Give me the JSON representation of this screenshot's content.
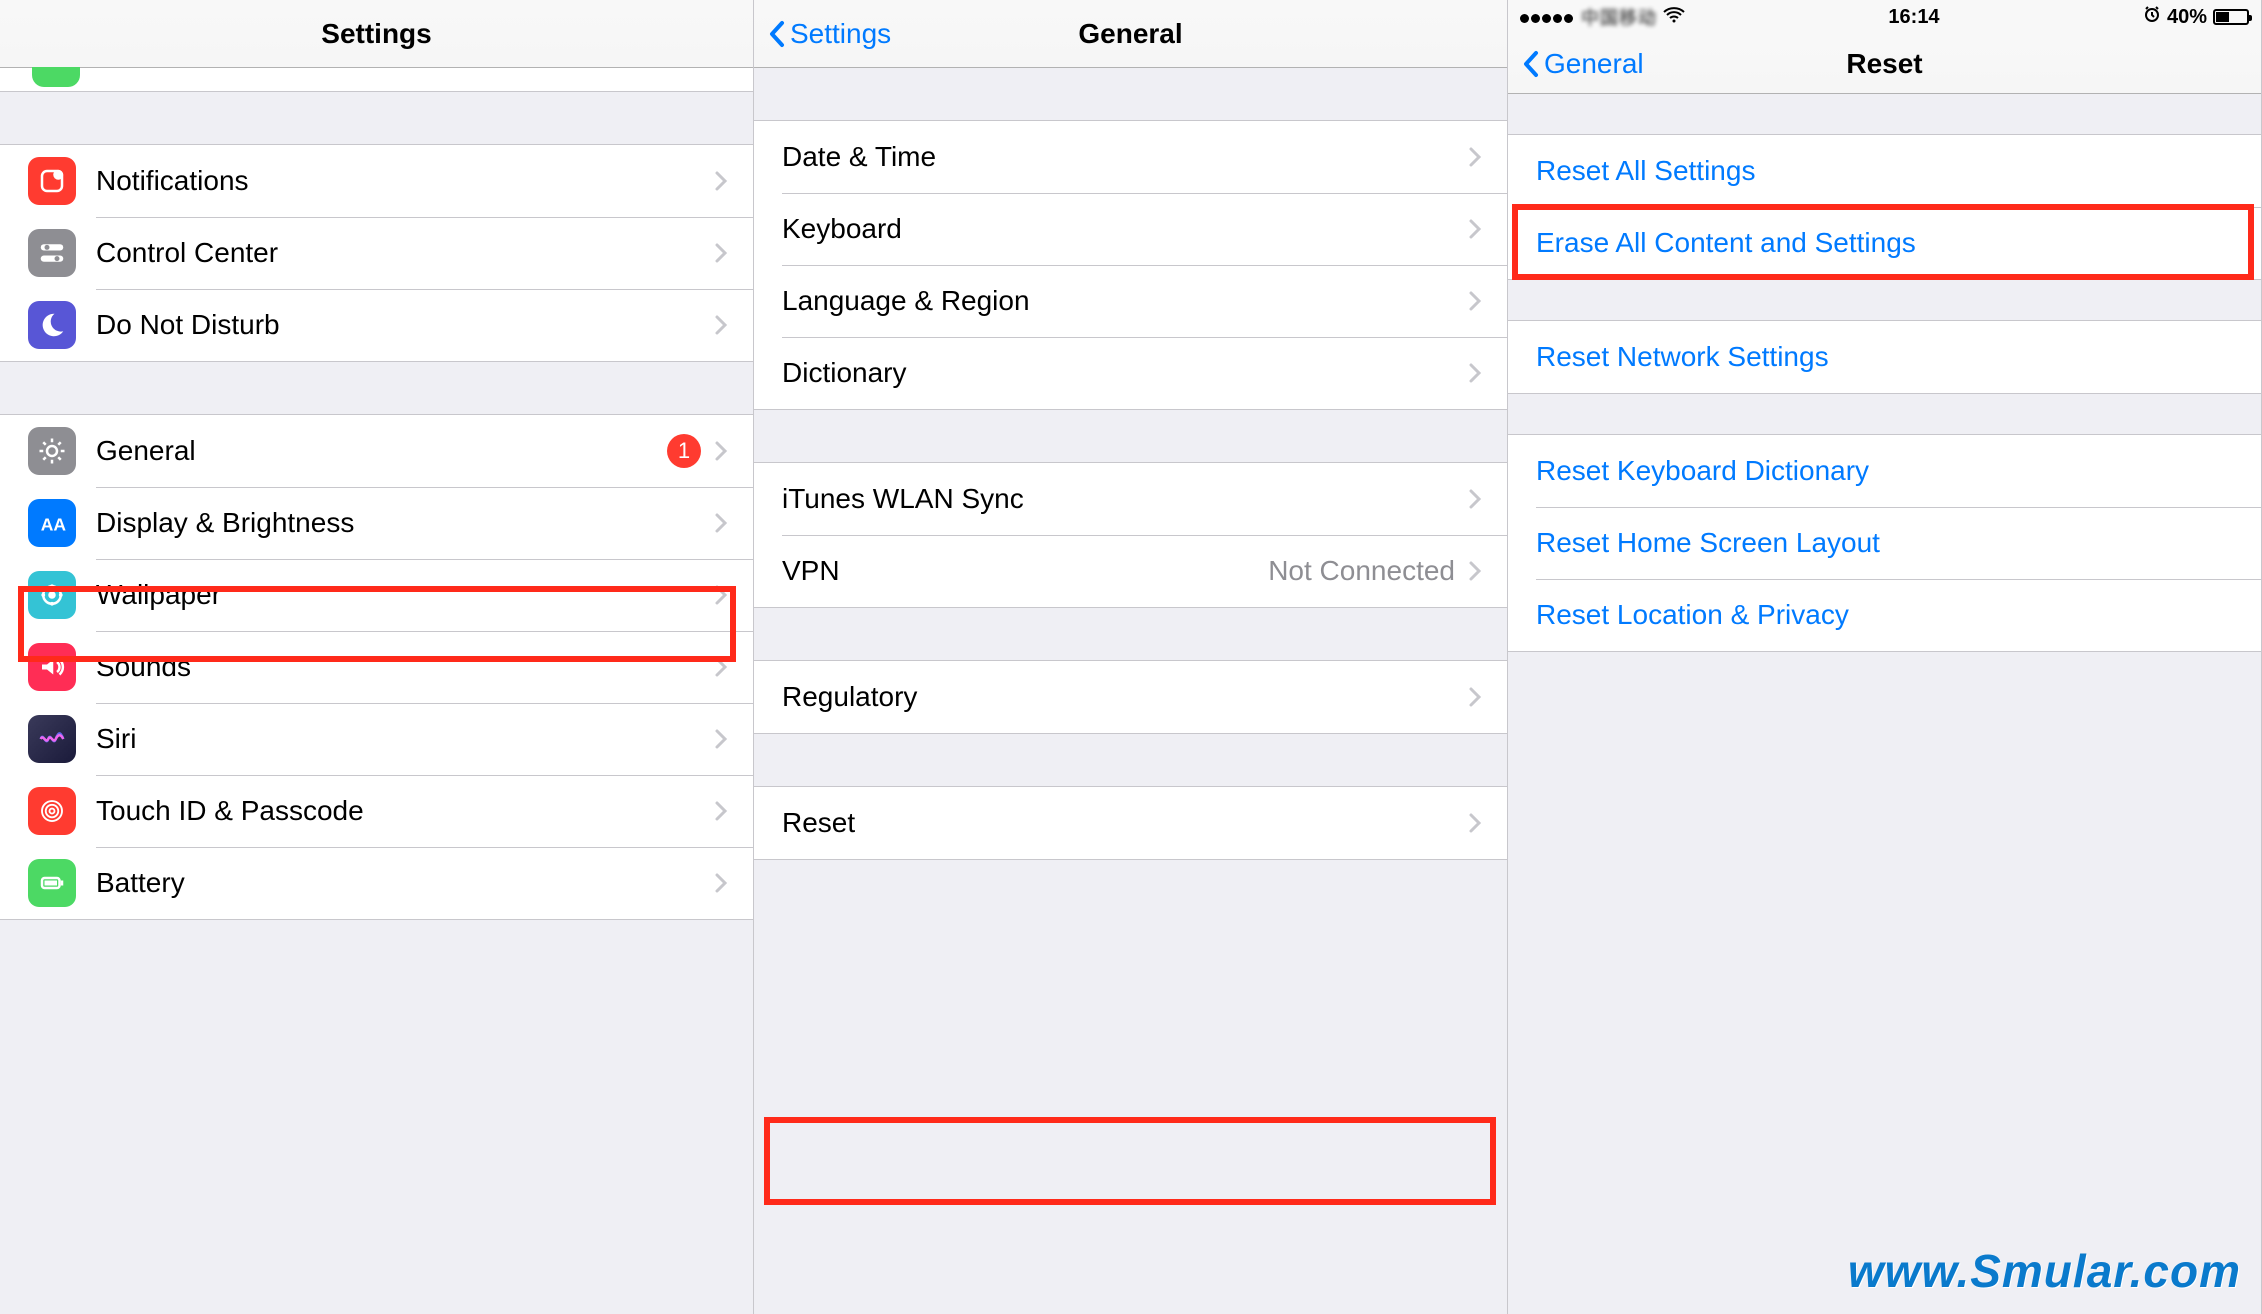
{
  "pane1": {
    "title": "Settings",
    "rows": [
      {
        "label": "Notifications"
      },
      {
        "label": "Control Center"
      },
      {
        "label": "Do Not Disturb"
      }
    ],
    "rows2": [
      {
        "label": "General",
        "badge": "1"
      },
      {
        "label": "Display & Brightness"
      },
      {
        "label": "Wallpaper"
      },
      {
        "label": "Sounds"
      },
      {
        "label": "Siri"
      },
      {
        "label": "Touch ID & Passcode"
      },
      {
        "label": "Battery"
      }
    ]
  },
  "pane2": {
    "back": "Settings",
    "title": "General",
    "group1": [
      {
        "label": "Date & Time"
      },
      {
        "label": "Keyboard"
      },
      {
        "label": "Language & Region"
      },
      {
        "label": "Dictionary"
      }
    ],
    "group2": [
      {
        "label": "iTunes WLAN Sync"
      },
      {
        "label": "VPN",
        "value": "Not Connected"
      }
    ],
    "group3": [
      {
        "label": "Regulatory"
      }
    ],
    "group4": [
      {
        "label": "Reset"
      }
    ]
  },
  "pane3": {
    "status": {
      "time": "16:14",
      "battery_pct": "40%"
    },
    "back": "General",
    "title": "Reset",
    "group1": [
      {
        "label": "Reset All Settings"
      },
      {
        "label": "Erase All Content and Settings"
      }
    ],
    "group2": [
      {
        "label": "Reset Network Settings"
      }
    ],
    "group3": [
      {
        "label": "Reset Keyboard Dictionary"
      },
      {
        "label": "Reset Home Screen Layout"
      },
      {
        "label": "Reset Location & Privacy"
      }
    ]
  },
  "watermark": "www.Smular.com"
}
